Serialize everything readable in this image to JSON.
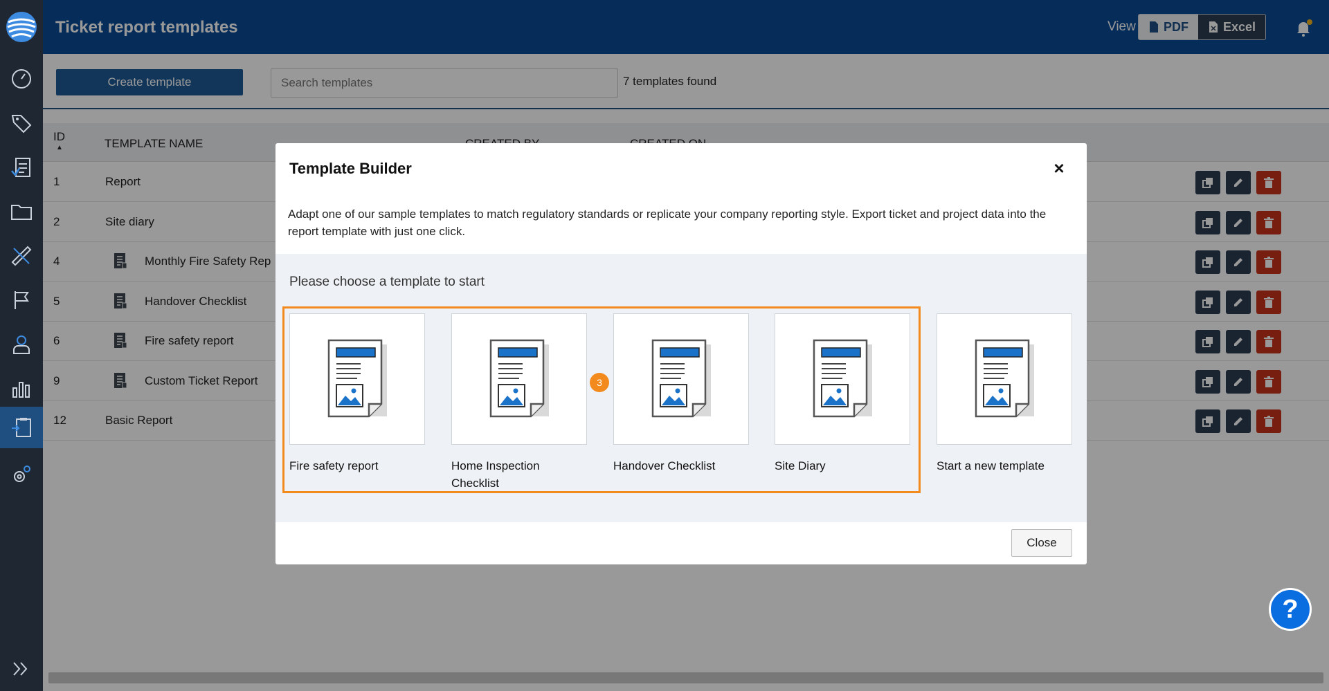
{
  "header": {
    "title": "Ticket report templates",
    "view_label": "View",
    "pdf_label": "PDF",
    "excel_label": "Excel"
  },
  "toolbar": {
    "create_label": "Create template",
    "search_placeholder": "Search templates",
    "found_text": "7 templates found"
  },
  "table": {
    "columns": [
      "ID",
      "TEMPLATE NAME",
      "CREATED BY",
      "CREATED ON"
    ],
    "rows": [
      {
        "id": "1",
        "name": "Report"
      },
      {
        "id": "2",
        "name": "Site diary"
      },
      {
        "id": "4",
        "name": "Monthly Fire Safety Rep"
      },
      {
        "id": "5",
        "name": "Handover Checklist"
      },
      {
        "id": "6",
        "name": "Fire safety report"
      },
      {
        "id": "9",
        "name": "Custom Ticket Report"
      },
      {
        "id": "12",
        "name": "Basic Report"
      }
    ]
  },
  "modal": {
    "title": "Template Builder",
    "close_x": "×",
    "description": "Adapt one of our sample templates to match regulatory standards or replicate your company reporting style. Export ticket and project data into the report template with just one click.",
    "choose": "Please choose a template to start",
    "step_badge": "3",
    "cards": [
      "Fire safety report",
      "Home Inspection Checklist",
      "Handover Checklist",
      "Site Diary",
      "Start a new template"
    ],
    "close_label": "Close"
  },
  "help_label": "?",
  "colors": {
    "header": "#0a4c97",
    "sidebar": "#1f2733",
    "accent_orange": "#f28a1e",
    "delete_red": "#c8321c",
    "help_blue": "#0a6de0"
  },
  "icons": {
    "sidebar": [
      "logo-icon",
      "dashboard-icon",
      "tag-icon",
      "checklist-icon",
      "folder-icon",
      "ruler-icon",
      "flag-icon",
      "user-icon",
      "chart-icon",
      "report-template-icon",
      "settings-icon",
      "expand-icon"
    ],
    "row_actions": [
      "copy-icon",
      "edit-icon",
      "delete-icon"
    ]
  }
}
